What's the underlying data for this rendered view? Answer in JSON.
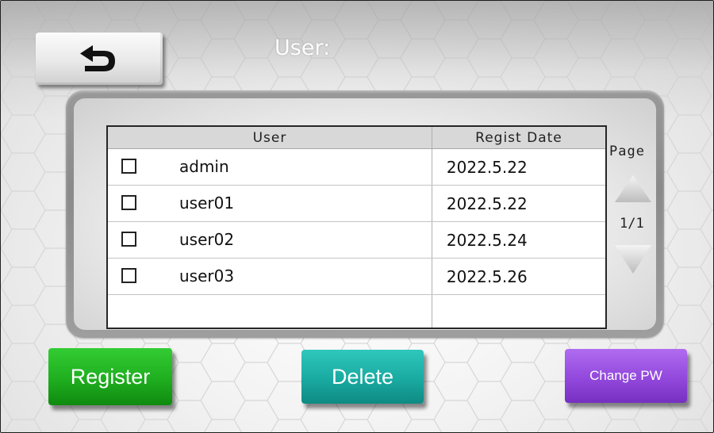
{
  "header": {
    "back_icon": "return-arrow-icon",
    "title": "User:"
  },
  "table": {
    "columns": [
      "User",
      "Regist Date"
    ],
    "rows": [
      {
        "checked": false,
        "user": "admin",
        "date": "2022.5.22"
      },
      {
        "checked": false,
        "user": "user01",
        "date": "2022.5.22"
      },
      {
        "checked": false,
        "user": "user02",
        "date": "2022.5.24"
      },
      {
        "checked": false,
        "user": "user03",
        "date": "2022.5.26"
      },
      {
        "checked": null,
        "user": "",
        "date": ""
      }
    ]
  },
  "pager": {
    "label": "Page",
    "indicator": "1/1",
    "up_icon": "triangle-up-icon",
    "down_icon": "triangle-down-icon"
  },
  "actions": {
    "register_label": "Register",
    "delete_label": "Delete",
    "change_pw_label": "Change PW"
  },
  "colors": {
    "register": "#1fae1f",
    "delete": "#19aaa1",
    "change_pw": "#9248dc",
    "panel": "#8f8f8f"
  }
}
